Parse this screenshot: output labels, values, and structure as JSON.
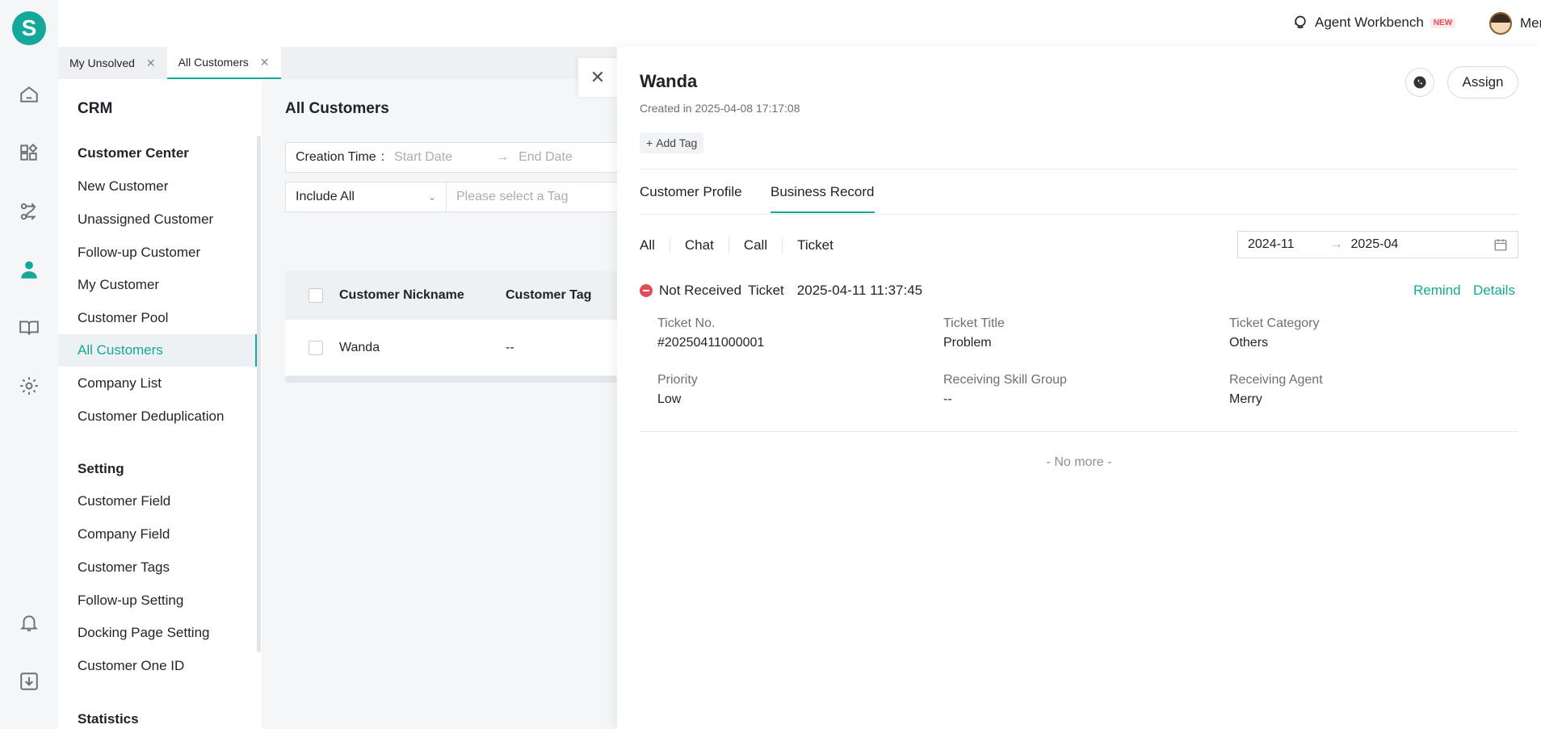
{
  "colors": {
    "brand": "#14a89a",
    "danger": "#e34d59"
  },
  "logo_letter": "S",
  "topbar": {
    "workbench_label": "Agent Workbench",
    "new_badge": "NEW",
    "user_name": "Merry"
  },
  "tabs": [
    {
      "label": "My Unsolved"
    },
    {
      "label": "All Customers"
    }
  ],
  "crm": {
    "title": "CRM",
    "sections": [
      {
        "title": "Customer Center"
      },
      {
        "title": "Setting"
      },
      {
        "title": "Statistics"
      }
    ],
    "customer_center_items": [
      "New Customer",
      "Unassigned Customer",
      "Follow-up Customer",
      "My Customer",
      "Customer Pool",
      "All Customers",
      "Company List",
      "Customer Deduplication"
    ],
    "setting_items": [
      "Customer Field",
      "Company Field",
      "Customer Tags",
      "Follow-up Setting",
      "Docking Page Setting",
      "Customer One ID"
    ]
  },
  "main": {
    "title": "All Customers",
    "creation_time_label": "Creation Time",
    "start_placeholder": "Start Date",
    "end_placeholder": "End Date",
    "include_select": "Include All",
    "tag_placeholder": "Please select a Tag",
    "columns": [
      "Customer Nickname",
      "Customer Tag"
    ],
    "rows": [
      {
        "nickname": "Wanda",
        "tag": "--"
      }
    ]
  },
  "drawer": {
    "name": "Wanda",
    "created": "Created in 2025-04-08 17:17:08",
    "add_tag": "Add Tag",
    "assign": "Assign",
    "tabs": [
      "Customer Profile",
      "Business Record"
    ],
    "filters": [
      "All",
      "Chat",
      "Call",
      "Ticket"
    ],
    "range_start": "2024-11",
    "range_end": "2025-04",
    "record": {
      "status": "Not Received",
      "type": "Ticket",
      "time": "2025-04-11 11:37:45",
      "remind": "Remind",
      "details": "Details",
      "fields": [
        {
          "key": "Ticket No.",
          "value": "#20250411000001"
        },
        {
          "key": "Ticket Title",
          "value": "Problem"
        },
        {
          "key": "Ticket Category",
          "value": "Others"
        },
        {
          "key": "Priority",
          "value": "Low"
        },
        {
          "key": "Receiving Skill Group",
          "value": "--"
        },
        {
          "key": "Receiving Agent",
          "value": "Merry"
        }
      ]
    },
    "no_more": "- No more -"
  }
}
